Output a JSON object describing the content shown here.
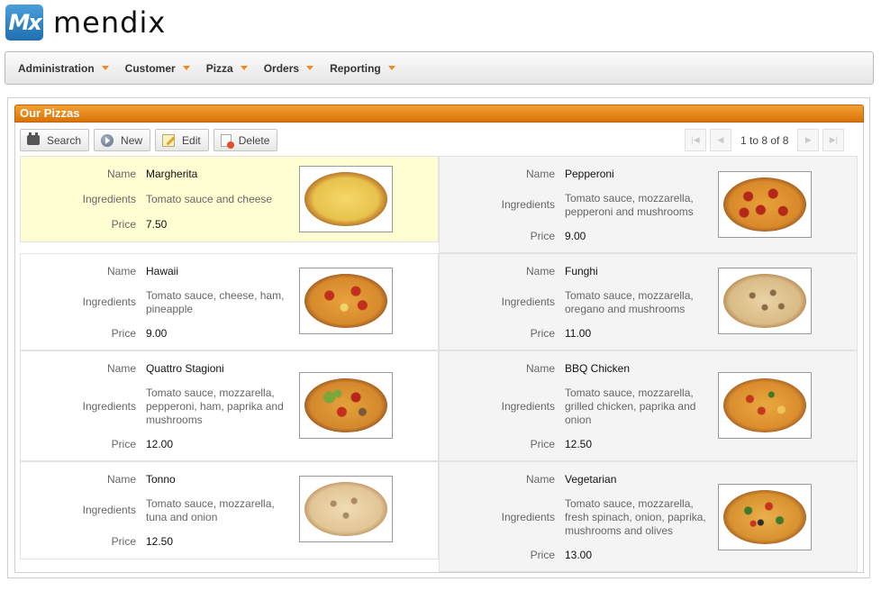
{
  "brand": {
    "logo_mark": "Mx",
    "logo_text": "mendix"
  },
  "nav": [
    {
      "label": "Administration"
    },
    {
      "label": "Customer"
    },
    {
      "label": "Pizza"
    },
    {
      "label": "Orders"
    },
    {
      "label": "Reporting"
    }
  ],
  "panel": {
    "title": "Our Pizzas"
  },
  "toolbar": {
    "search": "Search",
    "new": "New",
    "edit": "Edit",
    "delete": "Delete"
  },
  "pager": {
    "text": "1 to 8 of 8"
  },
  "field_labels": {
    "name": "Name",
    "ingredients": "Ingredients",
    "price": "Price"
  },
  "pizzas": [
    {
      "name": "Margherita",
      "ingredients": "Tomato sauce and cheese",
      "price": "7.50"
    },
    {
      "name": "Pepperoni",
      "ingredients": "Tomato sauce, mozzarella, pepperoni and mushrooms",
      "price": "9.00"
    },
    {
      "name": "Hawaii",
      "ingredients": "Tomato sauce, cheese, ham, pineapple",
      "price": "9.00"
    },
    {
      "name": "Funghi",
      "ingredients": "Tomato sauce, mozzarella, oregano and mushrooms",
      "price": "11.00"
    },
    {
      "name": "Quattro Stagioni",
      "ingredients": "Tomato sauce, mozzarella, pepperoni, ham, paprika and mushrooms",
      "price": "12.00"
    },
    {
      "name": "BBQ Chicken",
      "ingredients": "Tomato sauce, mozzarella, grilled chicken, paprika and onion",
      "price": "12.50"
    },
    {
      "name": "Tonno",
      "ingredients": "Tomato sauce, mozzarella, tuna and onion",
      "price": "12.50"
    },
    {
      "name": "Vegetarian",
      "ingredients": "Tomato sauce, mozzarella, fresh spinach, onion, paprika, mushrooms and olives",
      "price": "13.00"
    }
  ],
  "colors": {
    "accent_orange": "#d9730a",
    "selected_row": "#fffed2",
    "logo_blue": "#2f86c9"
  }
}
